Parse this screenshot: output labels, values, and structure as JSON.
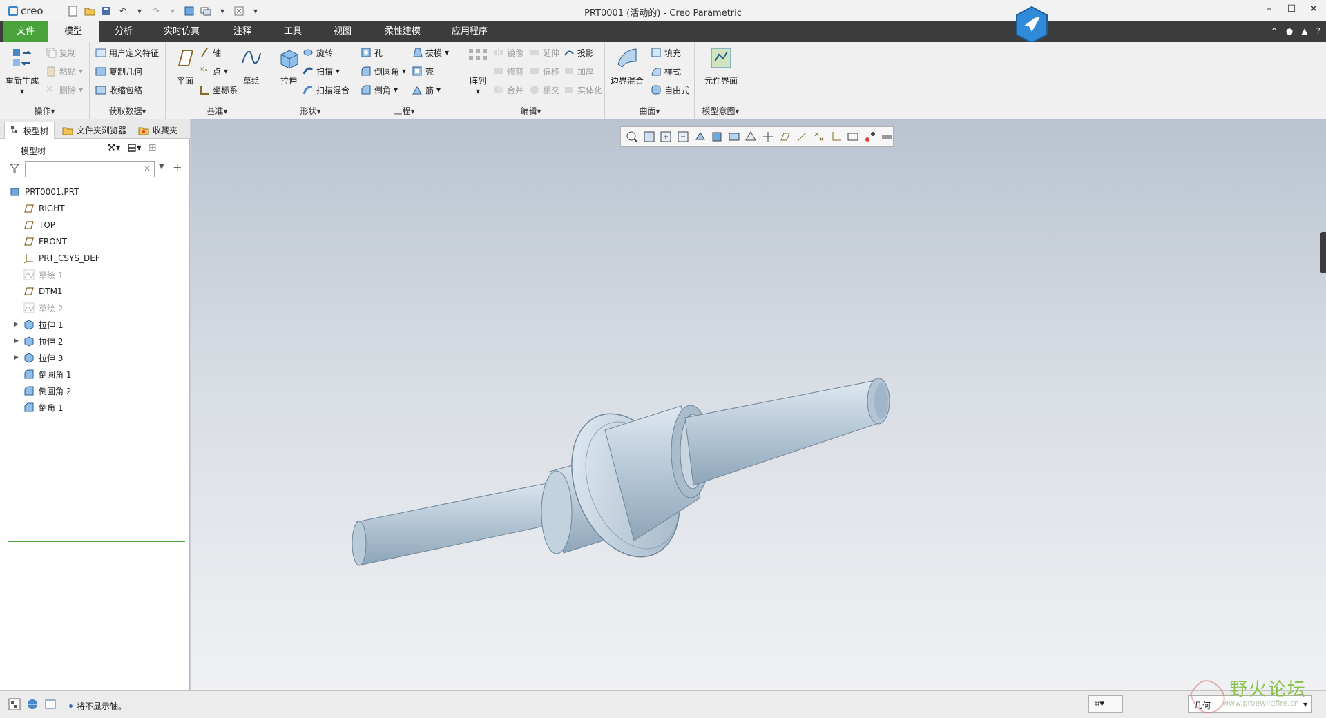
{
  "window": {
    "logo": "creo",
    "title": "PRT0001 (活动的) - Creo Parametric"
  },
  "menu": {
    "tabs": [
      "文件",
      "模型",
      "分析",
      "实时仿真",
      "注释",
      "工具",
      "视图",
      "柔性建模",
      "应用程序"
    ],
    "active": "模型"
  },
  "ribbon": {
    "ops": {
      "label": "操作",
      "regen": "重新生成",
      "copy": "复制",
      "paste": "粘贴",
      "delete": "删除"
    },
    "getdata": {
      "label": "获取数据",
      "udf": "用户定义特征",
      "copygeom": "复制几何",
      "shrink": "收缩包络"
    },
    "datum": {
      "label": "基准",
      "plane": "平面",
      "axis": "轴",
      "point": "点",
      "csys": "坐标系",
      "sketch": "草绘"
    },
    "shapes": {
      "label": "形状",
      "extrude": "拉伸",
      "revolve": "旋转",
      "sweep": "扫描",
      "sweptblend": "扫描混合"
    },
    "eng": {
      "label": "工程",
      "hole": "孔",
      "draft": "拔模",
      "round": "倒圆角",
      "shell": "壳",
      "chamfer": "倒角",
      "rib": "筋"
    },
    "edit": {
      "label": "编辑",
      "pattern": "阵列",
      "mirror": "镜像",
      "extend": "延伸",
      "project": "投影",
      "trim": "修剪",
      "offset": "偏移",
      "thicken": "加厚",
      "merge": "合并",
      "intersect": "相交",
      "solidify": "实体化"
    },
    "surfaces": {
      "label": "曲面",
      "boundary": "边界混合",
      "fill": "填充",
      "style": "样式",
      "freestyle": "自由式"
    },
    "intent": {
      "label": "模型意图",
      "component": "元件界面"
    }
  },
  "panel": {
    "tabs": [
      "模型树",
      "文件夹浏览器",
      "收藏夹"
    ],
    "tree_title": "模型树",
    "search_value": "",
    "nodes": [
      {
        "label": "PRT0001.PRT",
        "icon": "part-icon",
        "expandable": false,
        "dim": false
      },
      {
        "label": "RIGHT",
        "icon": "datum-plane-icon",
        "expandable": false,
        "dim": false
      },
      {
        "label": "TOP",
        "icon": "datum-plane-icon",
        "expandable": false,
        "dim": false
      },
      {
        "label": "FRONT",
        "icon": "datum-plane-icon",
        "expandable": false,
        "dim": false
      },
      {
        "label": "PRT_CSYS_DEF",
        "icon": "csys-icon",
        "expandable": false,
        "dim": false
      },
      {
        "label": "草绘 1",
        "icon": "sketch-icon",
        "expandable": false,
        "dim": true
      },
      {
        "label": "DTM1",
        "icon": "datum-plane-icon",
        "expandable": false,
        "dim": false
      },
      {
        "label": "草绘 2",
        "icon": "sketch-icon",
        "expandable": false,
        "dim": true
      },
      {
        "label": "拉伸 1",
        "icon": "extrude-icon",
        "expandable": true,
        "dim": false
      },
      {
        "label": "拉伸 2",
        "icon": "extrude-icon",
        "expandable": true,
        "dim": false
      },
      {
        "label": "拉伸 3",
        "icon": "extrude-icon",
        "expandable": true,
        "dim": false
      },
      {
        "label": "倒圆角 1",
        "icon": "round-icon",
        "expandable": false,
        "dim": false
      },
      {
        "label": "倒圆角 2",
        "icon": "round-icon",
        "expandable": false,
        "dim": false
      },
      {
        "label": "倒角 1",
        "icon": "chamfer-icon",
        "expandable": false,
        "dim": false
      }
    ]
  },
  "status": {
    "message": "将不显示轴。",
    "geometry_filter": "几何"
  },
  "watermark": {
    "text": "野火论坛",
    "url": "www.proewildfire.cn"
  }
}
